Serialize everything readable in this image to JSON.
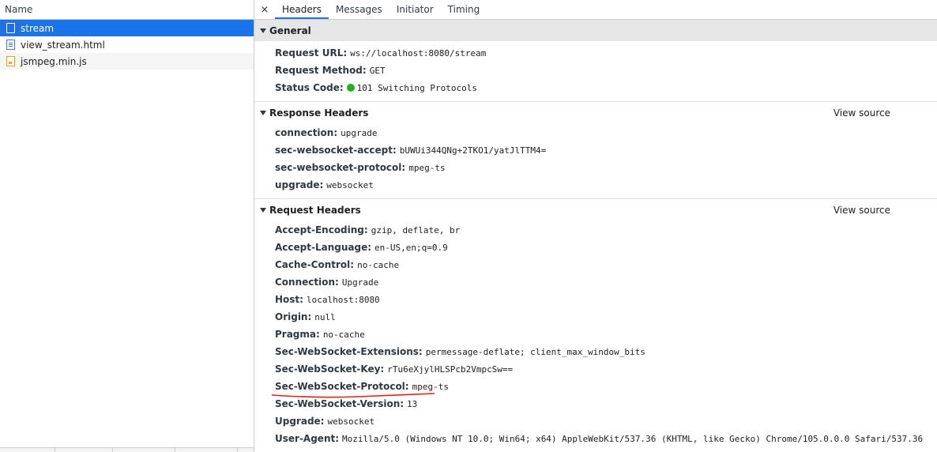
{
  "left": {
    "header": "Name",
    "items": [
      {
        "name": "stream",
        "icon": "websocket-icon"
      },
      {
        "name": "view_stream.html",
        "icon": "document-icon"
      },
      {
        "name": "jsmpeg.min.js",
        "icon": "script-icon"
      }
    ]
  },
  "tabs": {
    "close": "×",
    "items": [
      "Headers",
      "Messages",
      "Initiator",
      "Timing"
    ],
    "active": "Headers"
  },
  "general": {
    "title": "General",
    "rows": [
      {
        "name": "Request URL:",
        "value": "ws://localhost:8080/stream"
      },
      {
        "name": "Request Method:",
        "value": "GET"
      },
      {
        "name": "Status Code:",
        "value": "101 Switching Protocols"
      }
    ],
    "status_color": "#1fb21f"
  },
  "response": {
    "title": "Response Headers",
    "view_source": "View source",
    "rows": [
      {
        "name": "connection:",
        "value": "upgrade"
      },
      {
        "name": "sec-websocket-accept:",
        "value": "bUWUi344QNg+2TKO1/yatJlTTM4="
      },
      {
        "name": "sec-websocket-protocol:",
        "value": "mpeg-ts"
      },
      {
        "name": "upgrade:",
        "value": "websocket"
      }
    ]
  },
  "request": {
    "title": "Request Headers",
    "view_source": "View source",
    "rows": [
      {
        "name": "Accept-Encoding:",
        "value": "gzip, deflate, br"
      },
      {
        "name": "Accept-Language:",
        "value": "en-US,en;q=0.9"
      },
      {
        "name": "Cache-Control:",
        "value": "no-cache"
      },
      {
        "name": "Connection:",
        "value": "Upgrade"
      },
      {
        "name": "Host:",
        "value": "localhost:8080"
      },
      {
        "name": "Origin:",
        "value": "null"
      },
      {
        "name": "Pragma:",
        "value": "no-cache"
      },
      {
        "name": "Sec-WebSocket-Extensions:",
        "value": "permessage-deflate; client_max_window_bits"
      },
      {
        "name": "Sec-WebSocket-Key:",
        "value": "rTu6eXjylHLSPcb2VmpcSw=="
      },
      {
        "name": "Sec-WebSocket-Protocol:",
        "value": "mpeg-ts"
      },
      {
        "name": "Sec-WebSocket-Version:",
        "value": "13"
      },
      {
        "name": "Upgrade:",
        "value": "websocket"
      },
      {
        "name": "User-Agent:",
        "value": "Mozilla/5.0 (Windows NT 10.0; Win64; x64) AppleWebKit/537.36 (KHTML, like Gecko) Chrome/105.0.0.0 Safari/537.36"
      }
    ]
  },
  "colors": {
    "selection": "#1a73e8",
    "annotation": "#e02020"
  }
}
